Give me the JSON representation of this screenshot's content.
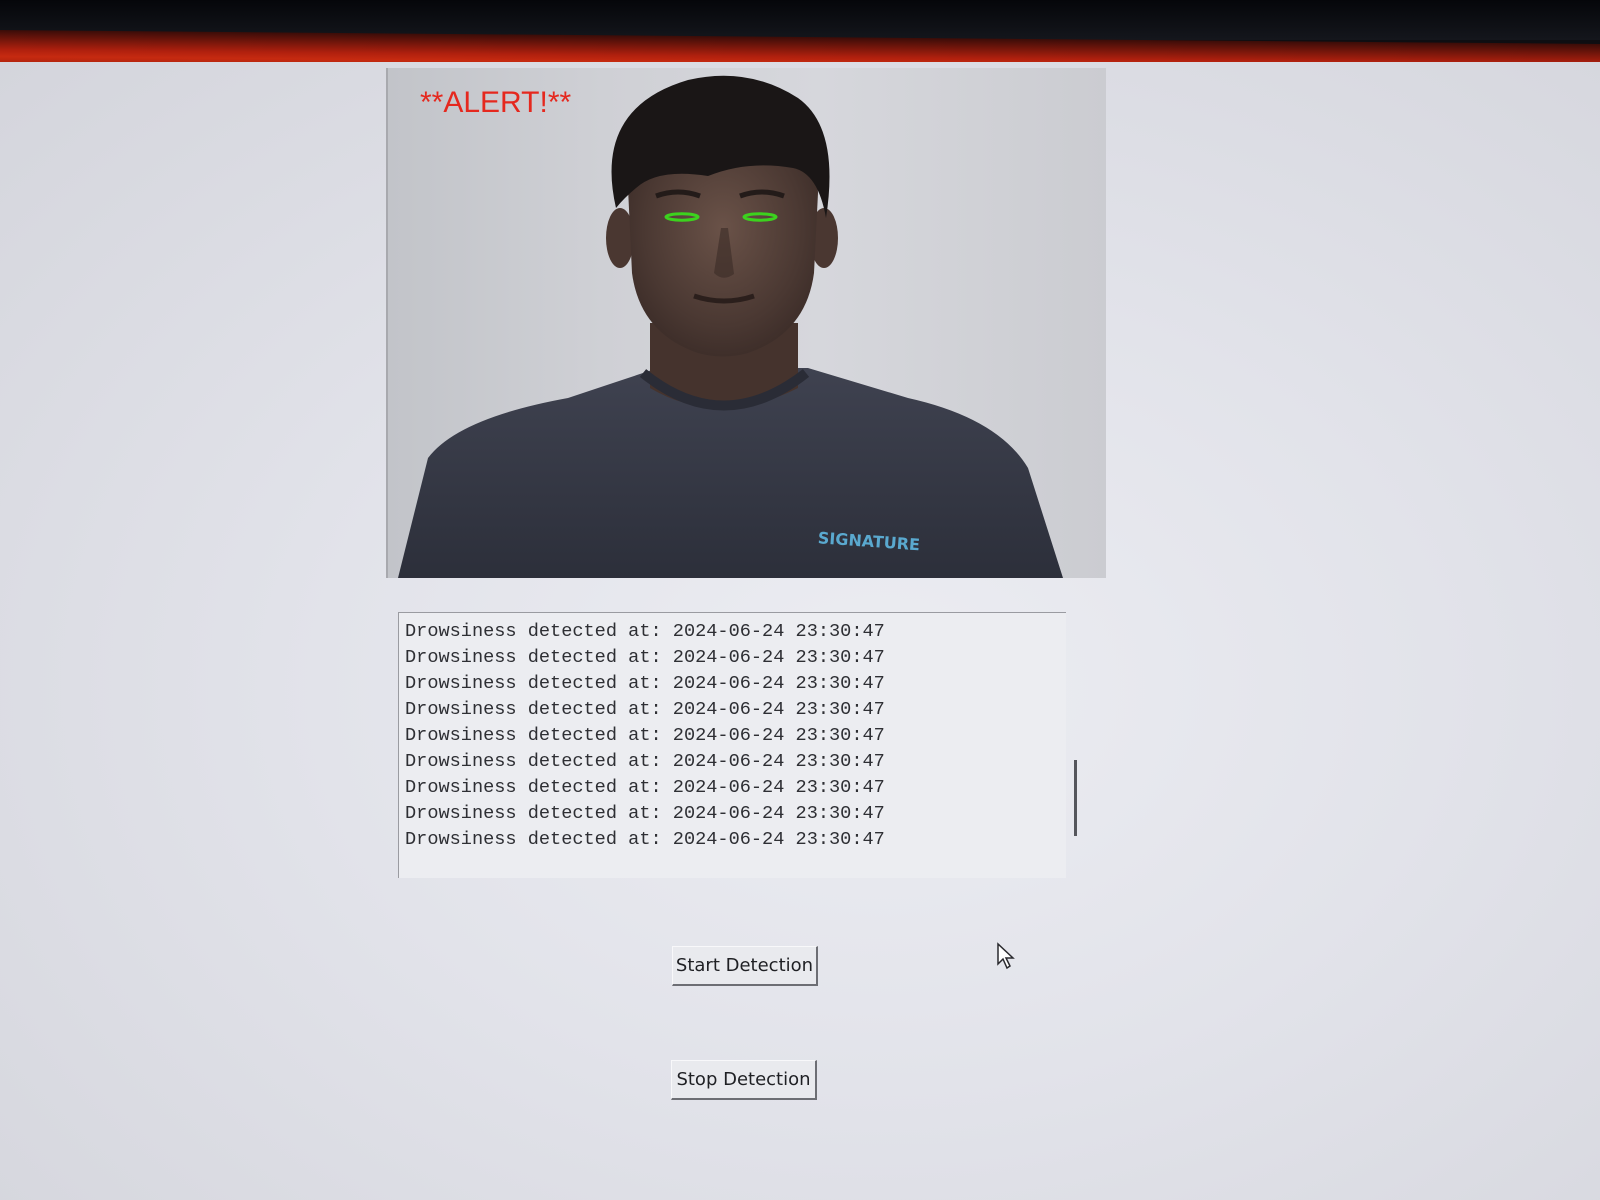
{
  "video": {
    "alert_text": "**ALERT!**",
    "shirt_text": "SIGNATURE",
    "eye_marker_color": "#3cd21e",
    "alert_color": "#e5281e"
  },
  "log": {
    "lines": [
      "Drowsiness detected at: 2024-06-24 23:30:47",
      "Drowsiness detected at: 2024-06-24 23:30:47",
      "Drowsiness detected at: 2024-06-24 23:30:47",
      "Drowsiness detected at: 2024-06-24 23:30:47",
      "Drowsiness detected at: 2024-06-24 23:30:47",
      "Drowsiness detected at: 2024-06-24 23:30:47",
      "Drowsiness detected at: 2024-06-24 23:30:47",
      "Drowsiness detected at: 2024-06-24 23:30:47",
      "Drowsiness detected at: 2024-06-24 23:30:47"
    ]
  },
  "buttons": {
    "start_label": "Start Detection",
    "stop_label": "Stop Detection"
  },
  "icons": {
    "cursor": "mouse-pointer-icon"
  }
}
